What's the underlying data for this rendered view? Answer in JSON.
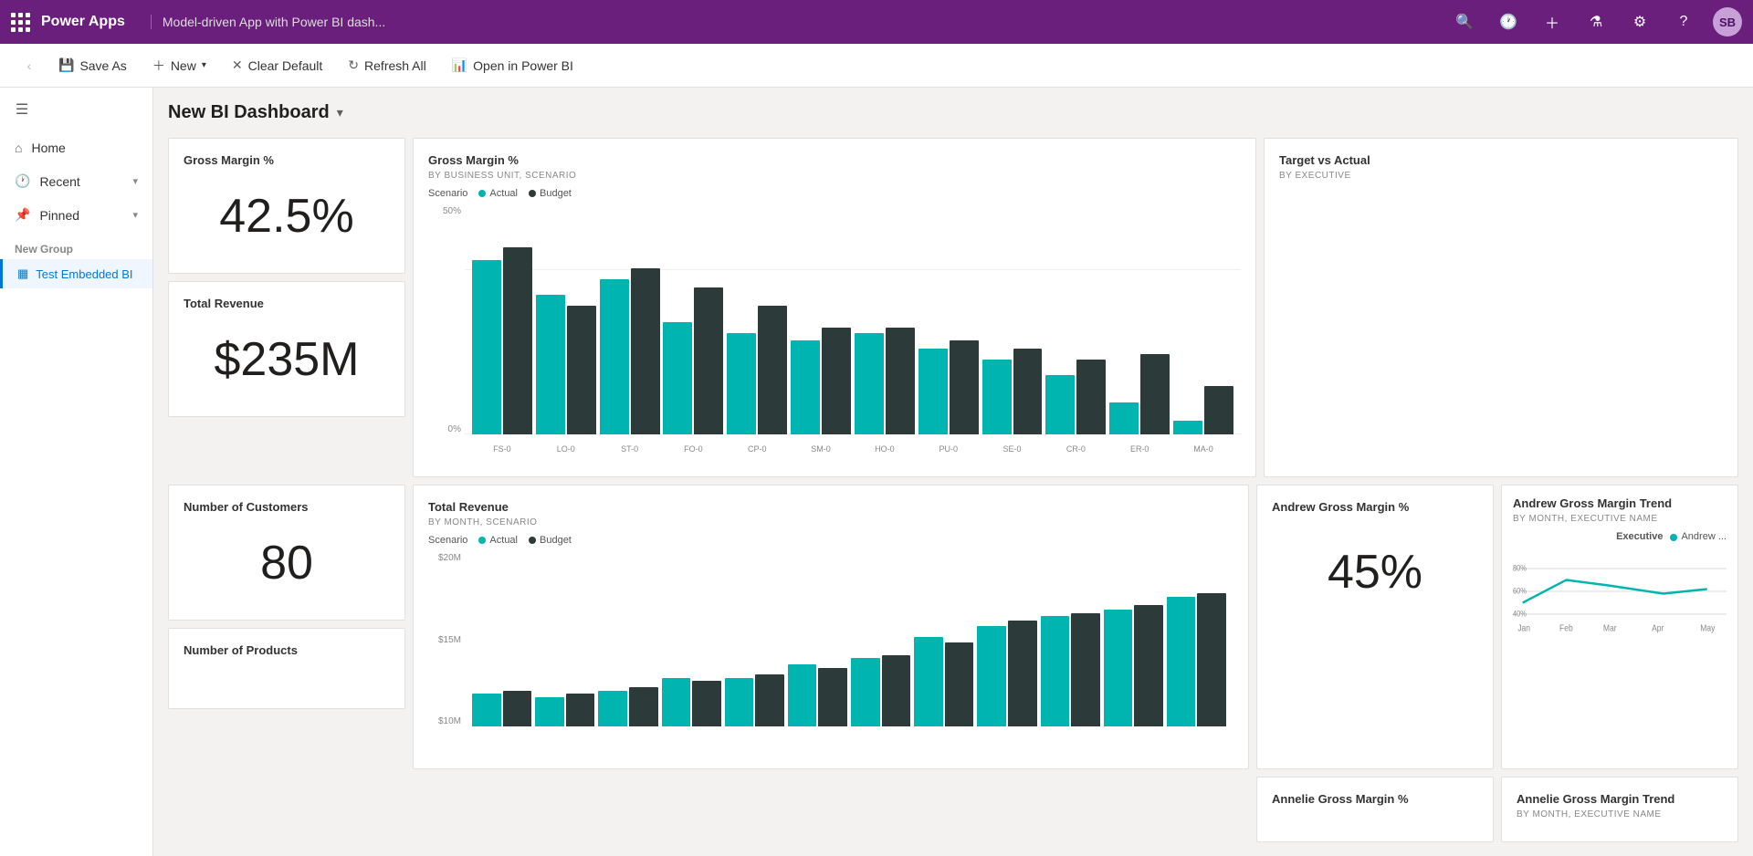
{
  "topnav": {
    "brand": "Power Apps",
    "title": "Model-driven App with Power BI dash...",
    "avatar_initials": "SB"
  },
  "commandbar": {
    "back_label": "‹",
    "save_as_label": "Save As",
    "new_label": "New",
    "clear_default_label": "Clear Default",
    "refresh_all_label": "Refresh All",
    "open_in_powerbi_label": "Open in Power BI"
  },
  "sidebar": {
    "home_label": "Home",
    "recent_label": "Recent",
    "pinned_label": "Pinned",
    "new_group_label": "New Group",
    "nav_item_label": "Test Embedded BI"
  },
  "page": {
    "title": "New BI Dashboard"
  },
  "cards": {
    "gross_margin_pct": {
      "title": "Gross Margin %",
      "value": "42.5%"
    },
    "total_revenue": {
      "title": "Total Revenue",
      "value": "$235M"
    },
    "number_of_customers": {
      "title": "Number of Customers",
      "value": "80"
    },
    "number_of_products": {
      "title": "Number of Products",
      "value": ""
    },
    "gross_margin_chart": {
      "title": "Gross Margin %",
      "subtitle": "BY BUSINESS UNIT, SCENARIO",
      "scenario_label": "Scenario",
      "legend_actual": "Actual",
      "legend_budget": "Budget",
      "y_labels": [
        "50%",
        "0%"
      ],
      "x_labels": [
        "FS-0",
        "LO-0",
        "ST-0",
        "FO-0",
        "CP-0",
        "SM-0",
        "HO-0",
        "PU-0",
        "SE-0",
        "CR-0",
        "ER-0",
        "MA-0"
      ],
      "bars_actual": [
        65,
        52,
        58,
        42,
        38,
        35,
        38,
        32,
        28,
        22,
        12,
        5
      ],
      "bars_budget": [
        70,
        48,
        62,
        55,
        48,
        40,
        40,
        35,
        32,
        28,
        30,
        18
      ]
    },
    "target_actual": {
      "title": "Target vs Actual",
      "subtitle": "BY EXECUTIVE"
    },
    "total_revenue_chart": {
      "title": "Total Revenue",
      "subtitle": "BY MONTH, SCENARIO",
      "scenario_label": "Scenario",
      "legend_actual": "Actual",
      "legend_budget": "Budget",
      "y_labels": [
        "$20M",
        "$15M",
        "$10M"
      ],
      "x_labels": [],
      "bars_actual": [
        20,
        18,
        22,
        30,
        30,
        38,
        42,
        55,
        62,
        68,
        72,
        80
      ],
      "bars_budget": [
        22,
        20,
        24,
        28,
        32,
        36,
        44,
        52,
        65,
        70,
        75,
        82
      ]
    },
    "andrew_gross_margin": {
      "title": "Andrew Gross Margin %",
      "value": "45%"
    },
    "andrew_trend": {
      "title": "Andrew Gross Margin Trend",
      "subtitle": "BY MONTH, EXECUTIVE NAME",
      "legend_executive": "Executive",
      "legend_andrew": "Andrew ...",
      "x_labels": [
        "Jan",
        "Feb",
        "Mar",
        "Apr",
        "May"
      ]
    },
    "annelie_gross_margin": {
      "title": "Annelie Gross Margin %"
    },
    "annelie_trend": {
      "title": "Annelie Gross Margin Trend",
      "subtitle": "BY MONTH, EXECUTIVE NAME"
    }
  }
}
